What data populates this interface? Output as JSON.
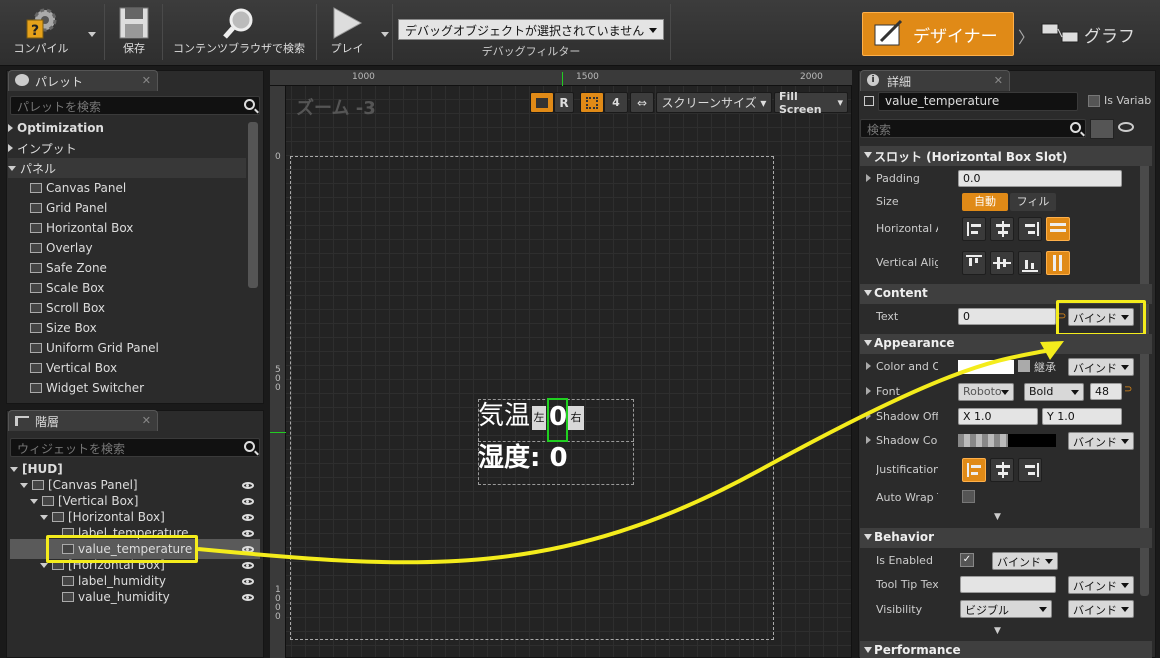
{
  "toolbar": {
    "compile": "コンパイル",
    "save": "保存",
    "browse": "コンテンツブラウザで検索",
    "play": "プレイ",
    "debug_select": "デバッグオブジェクトが選択されていません",
    "debug_filter": "デバッグフィルター",
    "designer": "デザイナー",
    "graph": "グラフ",
    "accent": "#e08a17"
  },
  "palette": {
    "title": "パレット",
    "search_placeholder": "パレットを検索",
    "categories": [
      "Optimization",
      "インプット",
      "パネル"
    ],
    "items": [
      "Canvas Panel",
      "Grid Panel",
      "Horizontal Box",
      "Overlay",
      "Safe Zone",
      "Scale Box",
      "Scroll Box",
      "Size Box",
      "Uniform Grid Panel",
      "Vertical Box",
      "Widget Switcher"
    ]
  },
  "hierarchy": {
    "title": "階層",
    "search_placeholder": "ウィジェットを検索",
    "root": "[HUD]",
    "nodes": [
      "[Canvas Panel]",
      "[Vertical Box]",
      "[Horizontal Box]",
      "label_temperature",
      "value_temperature",
      "[Horizontal Box]",
      "label_humidity",
      "value_humidity"
    ]
  },
  "viewport": {
    "zoom": "ズーム -3",
    "btn_r": "R",
    "btn_4": "4",
    "screen_size": "スクリーンサイズ",
    "fill_screen": "Fill Screen",
    "ruler_top": [
      "1000",
      "1500",
      "2000"
    ],
    "ruler_left": [
      "0",
      "5\n0\n0",
      "1\n0\n0\n0"
    ],
    "widget_label_temp": "気温",
    "widget_left": "左",
    "widget_value": "0",
    "widget_right": "右",
    "widget_humidity": "湿度: 0"
  },
  "details": {
    "title": "詳細",
    "name": "value_temperature",
    "is_variable": "Is Variab",
    "search_placeholder": "検索",
    "sections": {
      "slot": "スロット (Horizontal Box Slot)",
      "content": "Content",
      "appearance": "Appearance",
      "behavior": "Behavior",
      "performance": "Performance"
    },
    "padding_label": "Padding",
    "padding_value": "0.0",
    "size_label": "Size",
    "size_auto": "自動",
    "size_fill": "フィル",
    "halign_label": "Horizontal A",
    "valign_label": "Vertical Alig",
    "text_label": "Text",
    "text_value": "0",
    "bind": "バインド",
    "color_label": "Color and Op",
    "inherit": "継承",
    "font_label": "Font",
    "font_family": "Roboto",
    "font_style": "Bold",
    "font_size": "48",
    "shadow_offset_label": "Shadow Offs",
    "shadow_x": "X  1.0",
    "shadow_y": "Y  1.0",
    "shadow_color_label": "Shadow Colo",
    "justification_label": "Justification",
    "autowrap_label": "Auto Wrap T",
    "enabled_label": "Is Enabled",
    "tooltip_label": "Tool Tip Tex",
    "visibility_label": "Visibility",
    "visibility_value": "ビジブル"
  }
}
